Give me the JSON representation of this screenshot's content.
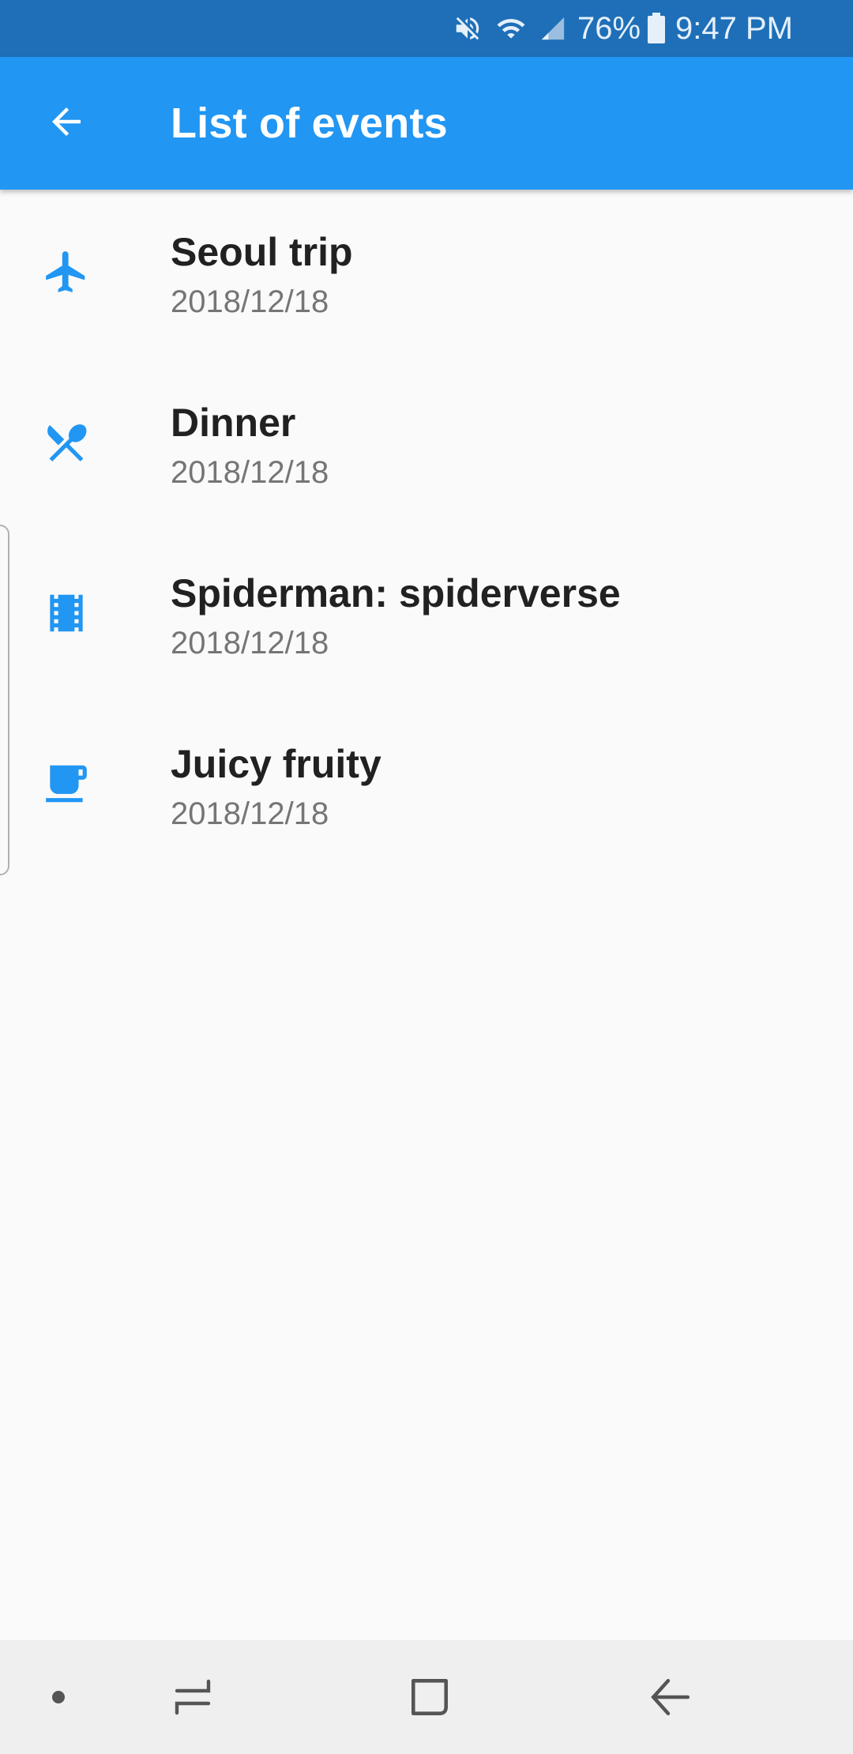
{
  "status_bar": {
    "battery_percent": "76%",
    "time": "9:47 PM",
    "icons": [
      "mute-icon",
      "wifi-icon",
      "signal-icon",
      "battery-icon"
    ]
  },
  "app_bar": {
    "title": "List of events",
    "back_icon": "arrow-back-icon",
    "color": "#2196f3"
  },
  "events": [
    {
      "title": "Seoul trip",
      "date": "2018/12/18",
      "icon": "airplane-icon"
    },
    {
      "title": "Dinner",
      "date": "2018/12/18",
      "icon": "restaurant-icon"
    },
    {
      "title": "Spiderman: spiderverse",
      "date": "2018/12/18",
      "icon": "movie-icon"
    },
    {
      "title": "Juicy fruity",
      "date": "2018/12/18",
      "icon": "cafe-icon"
    }
  ],
  "nav_bar": {
    "icons": [
      "dot-icon",
      "recents-icon",
      "home-icon",
      "back-nav-icon"
    ]
  },
  "colors": {
    "accent": "#2196f3",
    "status_bar": "#1e6fb8",
    "title_text": "#212121",
    "date_text": "#757575"
  }
}
